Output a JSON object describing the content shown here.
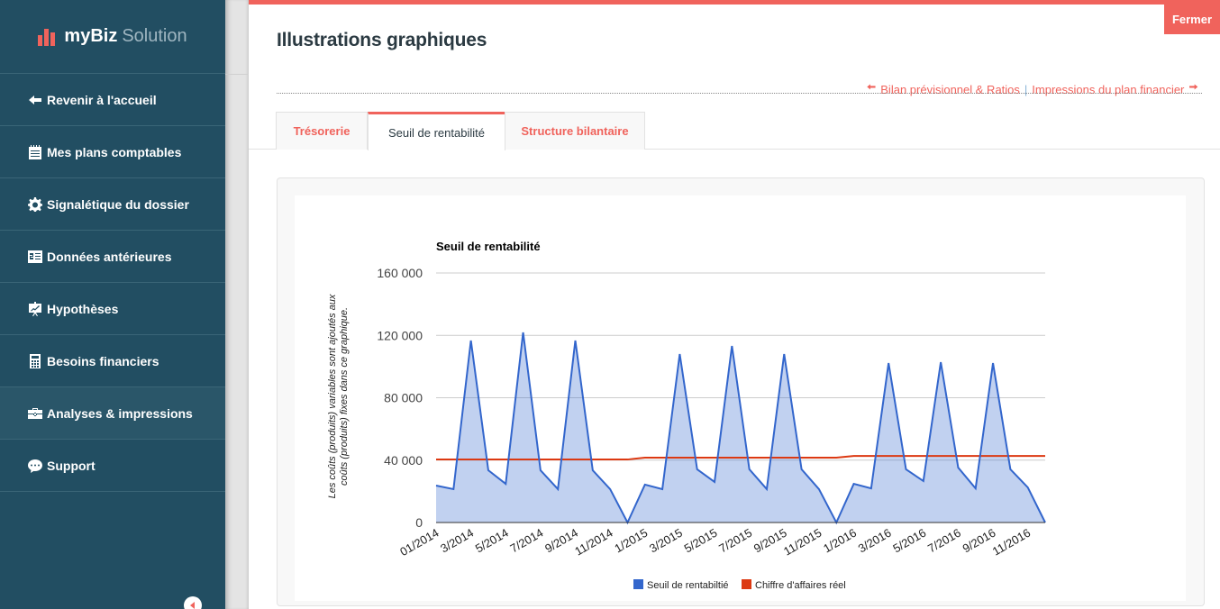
{
  "sidebar": {
    "brand_strong": "myBiz",
    "brand_light": "Solution",
    "items": [
      {
        "label": "Revenir à l'accueil",
        "icon": "arrow-left-icon",
        "active": false
      },
      {
        "label": "Mes plans comptables",
        "icon": "calendar-list-icon",
        "active": false
      },
      {
        "label": "Signalétique du dossier",
        "icon": "gear-icon",
        "active": false
      },
      {
        "label": "Données antérieures",
        "icon": "money-list-icon",
        "active": false
      },
      {
        "label": "Hypothèses",
        "icon": "presentation-chart-icon",
        "active": false
      },
      {
        "label": "Besoins financiers",
        "icon": "calculator-icon",
        "active": false
      },
      {
        "label": "Analyses & impressions",
        "icon": "briefcase-icon",
        "active": true
      },
      {
        "label": "Support",
        "icon": "chat-bubble-icon",
        "active": false
      }
    ]
  },
  "header": {
    "close_label": "Fermer",
    "title": "Illustrations graphiques",
    "prev_link": "Bilan prévisionnel & Ratios",
    "separator": "|",
    "next_link": "Impressions du plan financier"
  },
  "tabs": [
    {
      "label": "Trésorerie",
      "active": false
    },
    {
      "label": "Seuil de rentabilité",
      "active": true
    },
    {
      "label": "Structure bilantaire",
      "active": false
    }
  ],
  "colors": {
    "accent": "#f0635c",
    "sidebar": "#224e62",
    "series_blue": "#3366cc",
    "series_red": "#dc3912"
  },
  "chart_data": {
    "type": "area",
    "title": "Seuil de rentabilité",
    "ylabel_lines": [
      "Les coûts (produits) variables sont ajoutés aux",
      "coûts (produits) fixes dans ce graphique."
    ],
    "xlabel": "",
    "ylim": [
      0,
      160000
    ],
    "yticks": [
      0,
      40000,
      80000,
      120000,
      160000
    ],
    "ytick_labels": [
      "0",
      "40 000",
      "80 000",
      "120 000",
      "160 000"
    ],
    "grid": true,
    "legend_position": "bottom",
    "x": [
      "01/2014",
      "2/2014",
      "3/2014",
      "4/2014",
      "5/2014",
      "6/2014",
      "7/2014",
      "8/2014",
      "9/2014",
      "10/2014",
      "11/2014",
      "12/2014",
      "1/2015",
      "2/2015",
      "3/2015",
      "4/2015",
      "5/2015",
      "6/2015",
      "7/2015",
      "8/2015",
      "9/2015",
      "10/2015",
      "11/2015",
      "12/2015",
      "1/2016",
      "2/2016",
      "3/2016",
      "4/2016",
      "5/2016",
      "6/2016",
      "7/2016",
      "8/2016",
      "9/2016",
      "10/2016",
      "11/2016",
      "12/2016"
    ],
    "xtick_labels": [
      "01/2014",
      "3/2014",
      "5/2014",
      "7/2014",
      "9/2014",
      "11/2014",
      "1/2015",
      "3/2015",
      "5/2015",
      "7/2015",
      "9/2015",
      "11/2015",
      "1/2016",
      "3/2016",
      "5/2016",
      "7/2016",
      "9/2016",
      "11/2016"
    ],
    "series": [
      {
        "name": "Seuil de rentabiltié",
        "type": "area",
        "color": "#3366cc",
        "values": [
          23700,
          21400,
          116700,
          33500,
          24800,
          121900,
          33500,
          21400,
          116700,
          33500,
          21400,
          0,
          24300,
          21400,
          108000,
          34100,
          26000,
          113200,
          34100,
          21400,
          108000,
          34100,
          21400,
          0,
          24800,
          21900,
          102200,
          34100,
          26600,
          102800,
          35200,
          21900,
          102200,
          34100,
          22500,
          0
        ]
      },
      {
        "name": "Chiffre d'affaires réel",
        "type": "line",
        "color": "#dc3912",
        "values": [
          40400,
          40400,
          40400,
          40400,
          40400,
          40400,
          40400,
          40400,
          40400,
          40400,
          40400,
          40400,
          41600,
          41600,
          41600,
          41600,
          41600,
          41600,
          41600,
          41600,
          41600,
          41600,
          41600,
          41600,
          42700,
          42700,
          42700,
          42700,
          42700,
          42700,
          42700,
          42700,
          42700,
          42700,
          42700,
          42700
        ]
      }
    ]
  }
}
